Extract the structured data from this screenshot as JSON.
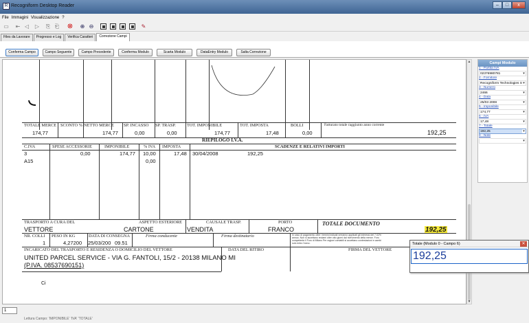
{
  "window": {
    "title": "Recogniform Desktop Reader",
    "controls": {
      "minimize": "–",
      "maximize": "□",
      "close": "x"
    }
  },
  "menu": [
    "File",
    "Immagini",
    "Visualizzazione",
    "?"
  ],
  "tabs": [
    "Files da Lavorare",
    "Progresso e Log",
    "Verifica Caratteri",
    "Correzione Campi"
  ],
  "active_tab_index": 3,
  "buttons": [
    "Conferma Campo",
    "Campo Seguente",
    "Campo Precedente",
    "Conferma Modulo",
    "Scarta Modulo",
    "DataEntry Modulo",
    "Salta Correzione"
  ],
  "document": {
    "totals_labels": [
      "TOTALE MERCE",
      "SCONTO %",
      "NETTO MERCE",
      "SP. INCASSO",
      "SP. TRASP.",
      "TOT. IMPONIBILE",
      "TOT. IMPOSTA",
      "BOLLI",
      "Fatturato totale raggiunto anno corrente"
    ],
    "totals_values": [
      "174,77",
      "174,77",
      "0,00",
      "0,00",
      "174,77",
      "17,48",
      "0,00",
      "192,25"
    ],
    "riepilogo": "RIEPILOGO I.V.A.",
    "vat_headers": [
      "C.IVA",
      "SPESE ACCESSORIE",
      "IMPONIBILE",
      "% IVA",
      "IMPOSTA",
      "SCADENZE E RELATIVI IMPORTI"
    ],
    "vat_row1": {
      "code": "3",
      "spese": "0,00",
      "imponibile": "174,77",
      "iva": "10,00",
      "imposta": "17,48",
      "date": "30/04/2008",
      "amount": "192,25"
    },
    "vat_row2": {
      "code": "A15",
      "iva": "0,00"
    },
    "shipping_labels": [
      "TRASPORTO A CURA DEL",
      "ASPETTO ESTERIORE",
      "CAUSALE TRASP.",
      "PORTO",
      "TOTALE DOCUMENTO"
    ],
    "shipping_values": [
      "VETTORE",
      "CARTONE",
      "VENDITA",
      "FRANCO",
      "192,25"
    ],
    "row3_labels": [
      "NR. COLLI",
      "PESO IN KG",
      "DATA DI CONSEGNA",
      "Firma conducente",
      "Firma destinatario"
    ],
    "row3_values": [
      "1",
      "4,27200",
      "25/03/200",
      "09.51"
    ],
    "legal_note": "In caso di pagamento oltre i termini indicati verranno applicati gli interessi del 7.02% annuo. Non si accettano reclami oltre otto giorni dal ricevimento della merce. Foro competente il Foro di Milano Per ragioni contabili si accettano contestazioni e cambi solo entro l'anno.",
    "carrier_labels": [
      "INCARICATO DEL TRASPORTO E RESIDENZA O DOMICILIO DEL VETTORE",
      "DATA DEL RITIRO",
      "FIRMA DEL VETTORE"
    ],
    "carrier_value": "UNITED PARCEL SERVICE  - VIA G. FANTOLI, 15/2  - 20138 MILANO  MI",
    "carrier_piva": "(P.IVA. 08537690151)",
    "footer_mark": "Ci"
  },
  "panel": {
    "title": "Campi Modulo",
    "fields": [
      {
        "label": "1 - Partita IVA",
        "value": "02376980781"
      },
      {
        "label": "2 - Fornitore",
        "value": "Recogniform Technologies SpA"
      },
      {
        "label": "3 - Numero",
        "value": "2466"
      },
      {
        "label": "4 - Data",
        "value": "25/03 2008"
      },
      {
        "label": "5 - Imponibile",
        "value": "174,77"
      },
      {
        "label": "6 - IVA",
        "value": "17,48"
      },
      {
        "label": "7 - Totale",
        "value": "192,25"
      },
      {
        "label": "8 - Note",
        "value": ""
      }
    ],
    "selected_index": 6
  },
  "popup": {
    "title": "Totale (Modulo 0 - Campo 6)",
    "value": "192,25"
  },
  "page_number": "1",
  "status_text": "Lettura Campo: 'IMPONIBILE' 'IVA' 'TOTALE'"
}
